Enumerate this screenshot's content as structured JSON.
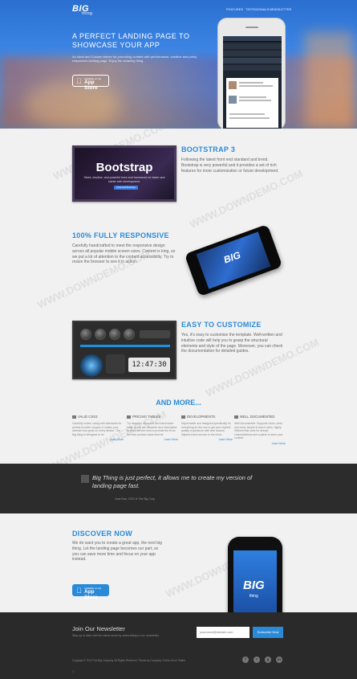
{
  "header": {
    "logo": "BIG",
    "logo_sub": "thing",
    "nav": [
      "FEATURES",
      "TESTIMONIALS",
      "NEWSLETTER"
    ]
  },
  "hero": {
    "title": "A PERFECT LANDING PAGE TO SHOWCASE YOUR APP",
    "text": "An Ideal and Custom theme for promoting content with performance, creative and pretty responsive landing page. Enjoy the amazing thing.",
    "store_small": "Available on the",
    "store_big": "App Store"
  },
  "sections": {
    "bootstrap": {
      "title": "BOOTSTRAP 3",
      "text": "Following the latest front end standard and trend. Bootstrap is very powerful and it provides a set of rich features for more customization or future development.",
      "img_title": "Bootstrap",
      "img_sub": "Sleek, intuitive, and powerful front-end framework for faster and easier web development.",
      "img_btn": "Download Bootstrap"
    },
    "responsive": {
      "title": "100% FULLY RESPONSIVE",
      "text": "Carefully handcrafted to meet the responsive design across all popular mobile screen sizes. Content is king, so we put a lot of attention to the content accessibility. Try to resize the browser to see it in action.",
      "phone_logo": "BIG"
    },
    "customize": {
      "title": "EASY TO CUSTOMIZE",
      "text": "Yes, it's easy to customize the template. Well-written and intuitive code will help you to grasp the structural elements and style of the page. Moreover, you can check the documentation for detailed guides.",
      "clock": "12:47:30"
    }
  },
  "more": {
    "title": "AND MORE...",
    "features": [
      {
        "title": "VALID CSS3",
        "text": "Carefully coded, using web standards for perfect browser support, it makes your website look great on every device. The Big thing is designed to be",
        "link": "Learn More"
      },
      {
        "title": "PRICING TABLES",
        "text": "Try beautiful, attractive and informative table, which are attractive and informative to show service best to provide the fit on the best product value best for",
        "link": "Learn More"
      },
      {
        "title": "DEVELOPMENTS",
        "text": "Dependable and designed specifically for everything for the use to get your highest quality, experience with web access, highest brand service in the mind.",
        "link": "Learn More"
      },
      {
        "title": "WELL DOCUMENTED",
        "text": "Well documented. Supports clean, clear and every simple to teach users, highly efficient that uses for deeper customizations and a place to store your content.",
        "link": "Learn More"
      }
    ]
  },
  "testimonial": {
    "quote": "Big Thing is just perfect, it allows me to create my version of landing page fast.",
    "author": "Jane Doe, CEO of The Big Corp"
  },
  "discover": {
    "title": "DISCOVER NOW",
    "text": "We do want you to create a great app, the next big thing. Let the landing page becomes our part, so you can save more time and focus on your app instead.",
    "store_small": "Available on the",
    "store_big": "App Store",
    "phone_logo": "BIG",
    "phone_sub": "thing"
  },
  "footer": {
    "newsletter_title": "Join Our Newsletter",
    "newsletter_text": "Stay up to date with the latest news by subscribing to our newsletter.",
    "input_placeholder": "yourname@domain.com",
    "subscribe_label": "Subscribe Now",
    "copyright": "Copyright © 2013 The Big Company. All Rights Reserved. Theme by Company. Follow Us on Twitter",
    "social": [
      "f",
      "t",
      "g",
      "in"
    ],
    "bottom_mark": "©"
  },
  "watermark": "WWW.DOWNDEMO.COM",
  "colors": {
    "accent": "#2a8ad8",
    "dark": "#2c2c2c",
    "light_bg": "#f1f1f1"
  }
}
